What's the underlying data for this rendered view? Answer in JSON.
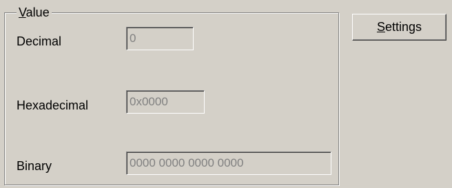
{
  "group": {
    "title_mnemonic": "V",
    "title_rest": "alue"
  },
  "fields": {
    "decimal": {
      "label": "Decimal",
      "value": "0"
    },
    "hexadecimal": {
      "label": "Hexadecimal",
      "value": "0x0000"
    },
    "binary": {
      "label": "Binary",
      "value": "0000 0000 0000 0000"
    }
  },
  "settings_button": {
    "mnemonic": "S",
    "rest": "ettings"
  },
  "colors": {
    "face": "#d4d0c8",
    "shadow": "#808080",
    "highlight": "#ffffff",
    "disabled_text": "#808080"
  }
}
